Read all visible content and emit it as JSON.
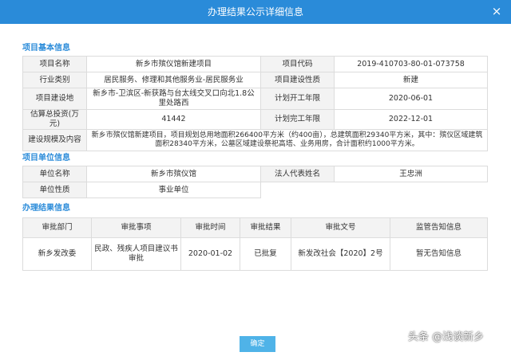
{
  "dialog": {
    "title": "办理结果公示详细信息",
    "close_label": "×"
  },
  "basic": {
    "heading": "项目基本信息",
    "project_name_label": "项目名称",
    "project_name": "新乡市殡仪馆新建项目",
    "project_code_label": "项目代码",
    "project_code": "2019-410703-80-01-073758",
    "industry_label": "行业类别",
    "industry": "居民服务、修理和其他服务业-居民服务业",
    "nature_label": "项目建设性质",
    "nature": "新建",
    "location_label": "项目建设地",
    "location": "新乡市-卫滨区-新获路与台太线交叉口向北1.8公里处路西",
    "start_label": "计划开工年限",
    "start": "2020-06-01",
    "investment_label": "估算总投资(万元)",
    "investment": "41442",
    "finish_label": "计划完工年限",
    "finish": "2022-12-01",
    "scale_label": "建设规模及内容",
    "scale": "新乡市殡仪馆新建项目，项目规划总用地面积266400平方米（约400亩），总建筑面积29340平方米，其中：殡仪区域建筑面积28340平方米，公墓区域建设祭祀高塔、业务用房，合计面积约1000平方米。"
  },
  "unit": {
    "heading": "项目单位信息",
    "unit_name_label": "单位名称",
    "unit_name": "新乡市殡仪馆",
    "rep_label": "法人代表姓名",
    "rep": "王忠洲",
    "unit_nature_label": "单位性质",
    "unit_nature": "事业单位"
  },
  "result": {
    "heading": "办理结果信息",
    "columns": [
      "审批部门",
      "审批事项",
      "审批时间",
      "审批结果",
      "审批文号",
      "监管告知信息"
    ],
    "rows": [
      [
        "新乡发改委",
        "民政、残疾人项目建议书审批",
        "2020-01-02",
        "已批复",
        "新发改社会【2020】2号",
        "暂无告知信息"
      ]
    ]
  },
  "footer": {
    "confirm_label": "确定"
  },
  "watermark": "头条 @浅谈新乡"
}
